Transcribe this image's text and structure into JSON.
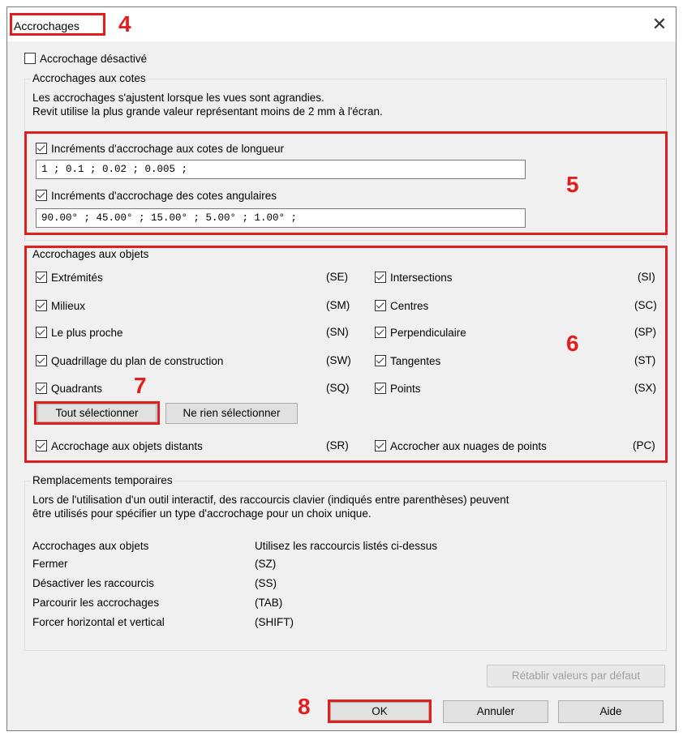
{
  "window": {
    "title": "Accrochages",
    "close_symbol": "✕"
  },
  "annotations": {
    "n4": "4",
    "n5": "5",
    "n6": "6",
    "n7": "7",
    "n8": "8"
  },
  "snap_disabled": {
    "label": "Accrochage désactivé",
    "checked": false
  },
  "dimension_snaps": {
    "title": "Accrochages aux cotes",
    "description_line1": "Les accrochages s'ajustent lorsque les vues sont agrandies.",
    "description_line2": "Revit utilise la plus grande valeur représentant moins de 2 mm à l'écran.",
    "length": {
      "label": "Incréments d'accrochage aux cotes de longueur",
      "checked": true,
      "value": "1 ; 0.1 ; 0.02 ; 0.005 ;"
    },
    "angular": {
      "label": "Incréments d'accrochage des cotes angulaires",
      "checked": true,
      "value": "90.00° ; 45.00° ; 15.00° ; 5.00° ; 1.00° ;"
    }
  },
  "object_snaps": {
    "title": "Accrochages aux objets",
    "left": [
      {
        "label": "Extrémités",
        "code": "(SE)",
        "checked": true
      },
      {
        "label": "Milieux",
        "code": "(SM)",
        "checked": true
      },
      {
        "label": "Le plus proche",
        "code": "(SN)",
        "checked": true
      },
      {
        "label": "Quadrillage du plan de construction",
        "code": "(SW)",
        "checked": true
      },
      {
        "label": "Quadrants",
        "code": "(SQ)",
        "checked": true
      }
    ],
    "right": [
      {
        "label": "Intersections",
        "code": "(SI)",
        "checked": true
      },
      {
        "label": "Centres",
        "code": "(SC)",
        "checked": true
      },
      {
        "label": "Perpendiculaire",
        "code": "(SP)",
        "checked": true
      },
      {
        "label": "Tangentes",
        "code": "(ST)",
        "checked": true
      },
      {
        "label": "Points",
        "code": "(SX)",
        "checked": true
      }
    ],
    "select_all": "Tout sélectionner",
    "select_none": "Ne rien sélectionner",
    "remote": {
      "label": "Accrochage aux objets distants",
      "code": "(SR)",
      "checked": true
    },
    "point_cloud": {
      "label": "Accrocher aux nuages de points",
      "code": "(PC)",
      "checked": true
    }
  },
  "temporary_overrides": {
    "title": "Remplacements temporaires",
    "description_line1": "Lors de l'utilisation d'un outil interactif, des raccourcis clavier (indiqués entre parenthèses) peuvent",
    "description_line2": "être utilisés pour spécifier un type d'accrochage pour un choix unique.",
    "rows": [
      {
        "label": "Accrochages aux objets",
        "value": "Utilisez les raccourcis listés ci-dessus"
      },
      {
        "label": "Fermer",
        "value": "(SZ)"
      },
      {
        "label": "Désactiver les raccourcis",
        "value": "(SS)"
      },
      {
        "label": "Parcourir les accrochages",
        "value": "(TAB)"
      },
      {
        "label": "Forcer horizontal et vertical",
        "value": "(SHIFT)"
      }
    ]
  },
  "buttons": {
    "restore_defaults": "Rétablir valeurs par défaut",
    "ok": "OK",
    "cancel": "Annuler",
    "help": "Aide"
  },
  "colors": {
    "annotation_red": "#e01e1e",
    "dialog_bg": "#f0f0f0"
  }
}
